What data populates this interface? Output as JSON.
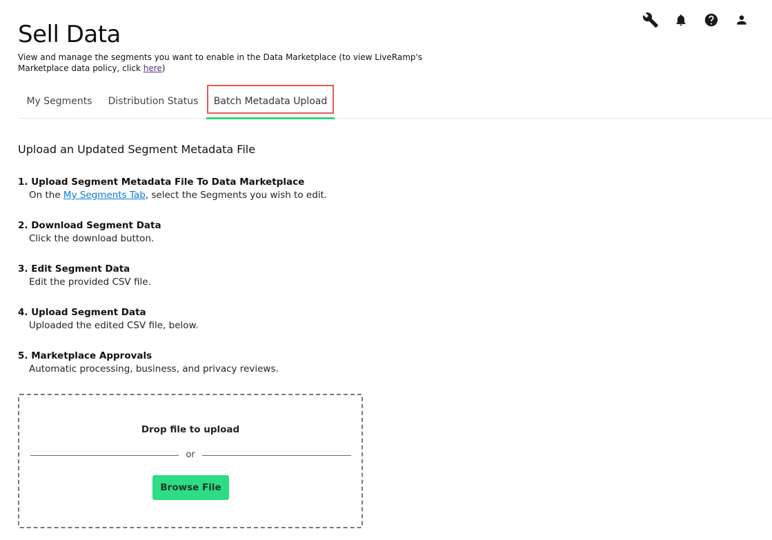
{
  "header": {
    "title": "Sell Data",
    "description_prefix": "View and manage the segments you want to enable in the Data Marketplace (to view LiveRamp's Marketplace data policy, click ",
    "description_link": "here",
    "description_suffix": ")"
  },
  "toolbar_icons": [
    "wrench-icon",
    "bell-icon",
    "help-icon",
    "user-icon"
  ],
  "tabs": [
    {
      "label": "My Segments"
    },
    {
      "label": "Distribution Status"
    },
    {
      "label": "Batch Metadata Upload",
      "active": true
    }
  ],
  "section": {
    "title": "Upload an Updated Segment Metadata File"
  },
  "steps": [
    {
      "title": "1. Upload Segment Metadata File To Data Marketplace",
      "desc_prefix": "On the ",
      "desc_link": "My Segments Tab",
      "desc_suffix": ", select the Segments you wish to edit."
    },
    {
      "title": "2. Download Segment Data",
      "desc": "Click the download button."
    },
    {
      "title": "3. Edit Segment Data",
      "desc": "Edit the provided CSV file."
    },
    {
      "title": "4. Upload Segment Data",
      "desc": "Uploaded the edited CSV file, below."
    },
    {
      "title": "5. Marketplace Approvals",
      "desc": "Automatic processing, business, and privacy reviews."
    }
  ],
  "upload": {
    "drop_label": "Drop file to upload",
    "or_label": "or",
    "browse_label": "Browse File"
  },
  "colors": {
    "accent_green": "#2fdc86",
    "tab_underline": "#2dd67d",
    "highlight_border": "#e25a50",
    "link_blue": "#0a7ad6",
    "link_purple": "#5b2c8f"
  }
}
